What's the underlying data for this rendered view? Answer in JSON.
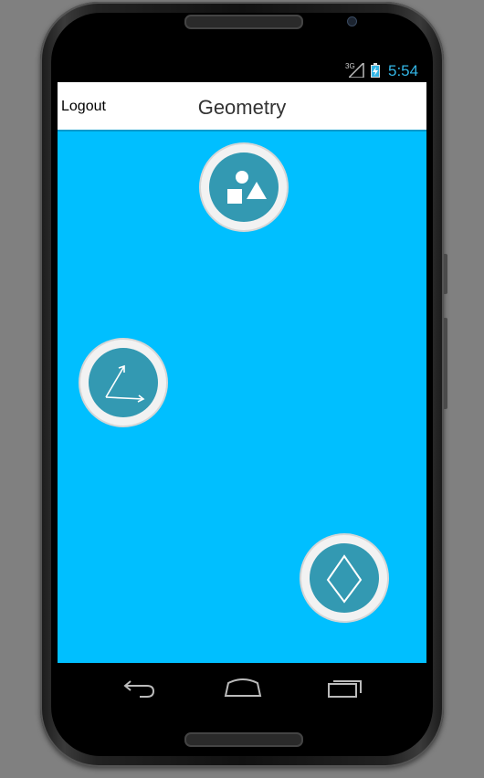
{
  "status_bar": {
    "network": "3G",
    "time": "5:54",
    "icons": [
      "signal-icon",
      "battery-charging-icon"
    ]
  },
  "app_bar": {
    "logout_label": "Logout",
    "title": "Geometry"
  },
  "menu_buttons": [
    {
      "icon": "shapes-icon"
    },
    {
      "icon": "angle-icon"
    },
    {
      "icon": "rhombus-icon"
    }
  ],
  "nav_bar": {
    "icons": [
      "back-icon",
      "home-icon",
      "recents-icon"
    ]
  },
  "colors": {
    "content_background": "#00bfff",
    "button_fill": "#3399b2",
    "button_ring": "#f2f2f2",
    "clock": "#33b5e5"
  }
}
